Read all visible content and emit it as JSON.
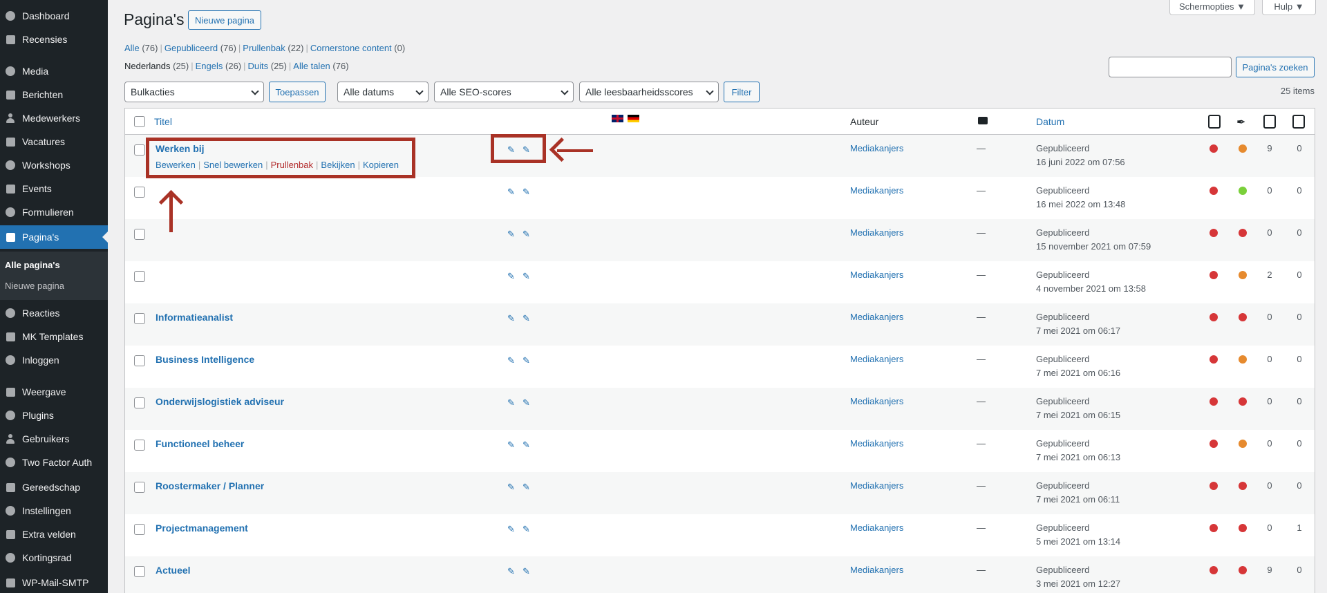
{
  "sidebar": {
    "items": [
      {
        "label": "Dashboard",
        "icon": "dashboard-icon"
      },
      {
        "label": "Recensies",
        "icon": "star-icon"
      },
      {
        "label": "Media",
        "icon": "media-icon"
      },
      {
        "label": "Berichten",
        "icon": "pin-icon"
      },
      {
        "label": "Medewerkers",
        "icon": "person-icon"
      },
      {
        "label": "Vacatures",
        "icon": "document-icon"
      },
      {
        "label": "Workshops",
        "icon": "gear-icon"
      },
      {
        "label": "Events",
        "icon": "calendar-icon"
      },
      {
        "label": "Formulieren",
        "icon": "forms-icon"
      },
      {
        "label": "Pagina's",
        "icon": "pages-icon",
        "active": true
      },
      {
        "label": "Reacties",
        "icon": "comment-icon"
      },
      {
        "label": "MK Templates",
        "icon": "pin-icon"
      },
      {
        "label": "Inloggen",
        "icon": "pin-icon"
      },
      {
        "label": "Weergave",
        "icon": "brush-icon"
      },
      {
        "label": "Plugins",
        "icon": "plugin-icon"
      },
      {
        "label": "Gebruikers",
        "icon": "person-icon"
      },
      {
        "label": "Two Factor Auth",
        "icon": "shield-icon"
      },
      {
        "label": "Gereedschap",
        "icon": "wrench-icon"
      },
      {
        "label": "Instellingen",
        "icon": "settings-icon"
      },
      {
        "label": "Extra velden",
        "icon": "table-icon"
      },
      {
        "label": "Kortingsrad",
        "icon": "gear-icon"
      },
      {
        "label": "WP-Mail-SMTP",
        "icon": "mail-icon"
      }
    ],
    "submenu": [
      "Alle pagina's",
      "Nieuwe pagina"
    ]
  },
  "header": {
    "title": "Pagina's",
    "new_page": "Nieuwe pagina",
    "screen_options": "Schermopties ▼",
    "help": "Hulp ▼"
  },
  "views": [
    {
      "label": "Alle",
      "count": "(76)"
    },
    {
      "label": "Gepubliceerd",
      "count": "(76)"
    },
    {
      "label": "Prullenbak",
      "count": "(22)"
    },
    {
      "label": "Cornerstone content",
      "count": "(0)"
    }
  ],
  "languages": [
    {
      "label": "Nederlands",
      "count": "(25)",
      "current": true
    },
    {
      "label": "Engels",
      "count": "(26)"
    },
    {
      "label": "Duits",
      "count": "(25)"
    },
    {
      "label": "Alle talen",
      "count": "(76)"
    }
  ],
  "filters": {
    "bulk": "Bulkacties",
    "apply": "Toepassen",
    "dates": "Alle datums",
    "seo": "Alle SEO-scores",
    "readability": "Alle leesbaarheidsscores",
    "filter": "Filter",
    "search_button": "Pagina's zoeken",
    "items_count": "25 items"
  },
  "table": {
    "headers": {
      "title": "Titel",
      "author": "Auteur",
      "date": "Datum"
    },
    "row_actions": [
      "Bewerken",
      "Snel bewerken",
      "Prullenbak",
      "Bekijken",
      "Kopieren"
    ],
    "colors": {
      "red": "#d63638",
      "orange": "#e68a2e",
      "green": "#7ad03a"
    },
    "rows": [
      {
        "title": "Werken bij",
        "author": "Mediakanjers",
        "comments": "—",
        "status": "Gepubliceerd",
        "date": "16 juni 2022 om 07:56",
        "seo": "red",
        "read": "orange",
        "links_in": "9",
        "links_out": "0"
      },
      {
        "title": "",
        "author": "Mediakanjers",
        "comments": "—",
        "status": "Gepubliceerd",
        "date": "16 mei 2022 om 13:48",
        "seo": "red",
        "read": "green",
        "links_in": "0",
        "links_out": "0"
      },
      {
        "title": "",
        "author": "Mediakanjers",
        "comments": "—",
        "status": "Gepubliceerd",
        "date": "15 november 2021 om 07:59",
        "seo": "red",
        "read": "red",
        "links_in": "0",
        "links_out": "0"
      },
      {
        "title": "",
        "author": "Mediakanjers",
        "comments": "—",
        "status": "Gepubliceerd",
        "date": "4 november 2021 om 13:58",
        "seo": "red",
        "read": "orange",
        "links_in": "2",
        "links_out": "0"
      },
      {
        "title": "Informatieanalist",
        "author": "Mediakanjers",
        "comments": "—",
        "status": "Gepubliceerd",
        "date": "7 mei 2021 om 06:17",
        "seo": "red",
        "read": "red",
        "links_in": "0",
        "links_out": "0"
      },
      {
        "title": "Business Intelligence",
        "author": "Mediakanjers",
        "comments": "—",
        "status": "Gepubliceerd",
        "date": "7 mei 2021 om 06:16",
        "seo": "red",
        "read": "orange",
        "links_in": "0",
        "links_out": "0"
      },
      {
        "title": "Onderwijslogistiek adviseur",
        "author": "Mediakanjers",
        "comments": "—",
        "status": "Gepubliceerd",
        "date": "7 mei 2021 om 06:15",
        "seo": "red",
        "read": "red",
        "links_in": "0",
        "links_out": "0"
      },
      {
        "title": "Functioneel beheer",
        "author": "Mediakanjers",
        "comments": "—",
        "status": "Gepubliceerd",
        "date": "7 mei 2021 om 06:13",
        "seo": "red",
        "read": "orange",
        "links_in": "0",
        "links_out": "0"
      },
      {
        "title": "Roostermaker / Planner",
        "author": "Mediakanjers",
        "comments": "—",
        "status": "Gepubliceerd",
        "date": "7 mei 2021 om 06:11",
        "seo": "red",
        "read": "red",
        "links_in": "0",
        "links_out": "0"
      },
      {
        "title": "Projectmanagement",
        "author": "Mediakanjers",
        "comments": "—",
        "status": "Gepubliceerd",
        "date": "5 mei 2021 om 13:14",
        "seo": "red",
        "read": "red",
        "links_in": "0",
        "links_out": "1"
      },
      {
        "title": "Actueel",
        "author": "Mediakanjers",
        "comments": "—",
        "status": "Gepubliceerd",
        "date": "3 mei 2021 om 12:27",
        "seo": "red",
        "read": "red",
        "links_in": "9",
        "links_out": "0"
      }
    ]
  }
}
